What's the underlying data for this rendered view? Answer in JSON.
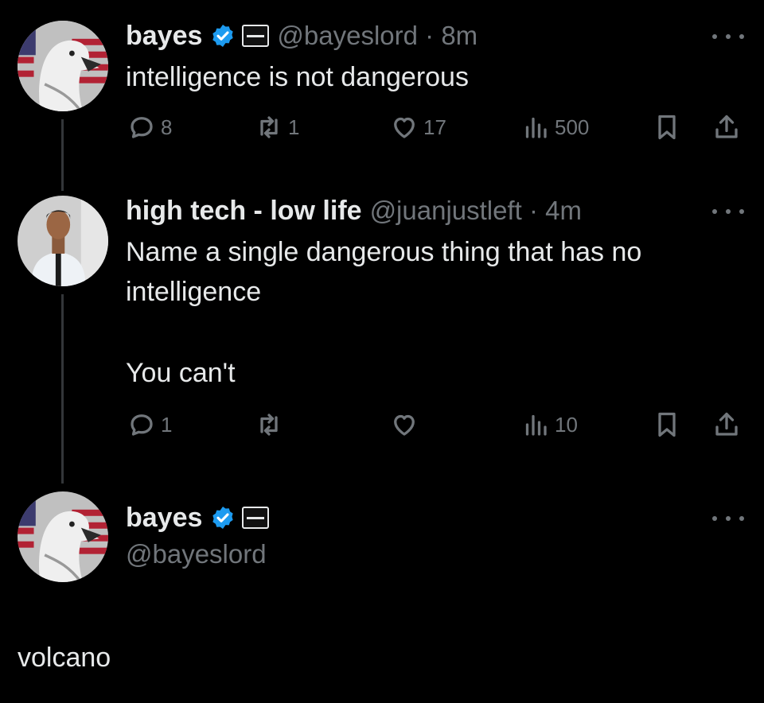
{
  "tweet1": {
    "name": "bayes",
    "handle_time": "@bayeslord · 8m",
    "text": "intelligence is not dangerous",
    "replies": "8",
    "retweets": "1",
    "likes": "17",
    "views": "500"
  },
  "tweet2": {
    "name": "high tech - low life",
    "handle_time": "@juanjustleft · 4m",
    "text_line1": "Name a single dangerous thing that has no",
    "text_line2": "intelligence",
    "text_line3": "You can't",
    "replies": "1",
    "views": "10"
  },
  "tweet3": {
    "name": "bayes",
    "handle": "@bayeslord",
    "text": "volcano"
  },
  "colors": {
    "background": "#000000",
    "text": "#e7e9ea",
    "secondary": "#71767b",
    "verified": "#1d9bf0"
  },
  "icons": [
    "reply-icon",
    "retweet-icon",
    "like-icon",
    "views-icon",
    "bookmark-icon",
    "share-icon",
    "verified-icon",
    "more-icon"
  ]
}
